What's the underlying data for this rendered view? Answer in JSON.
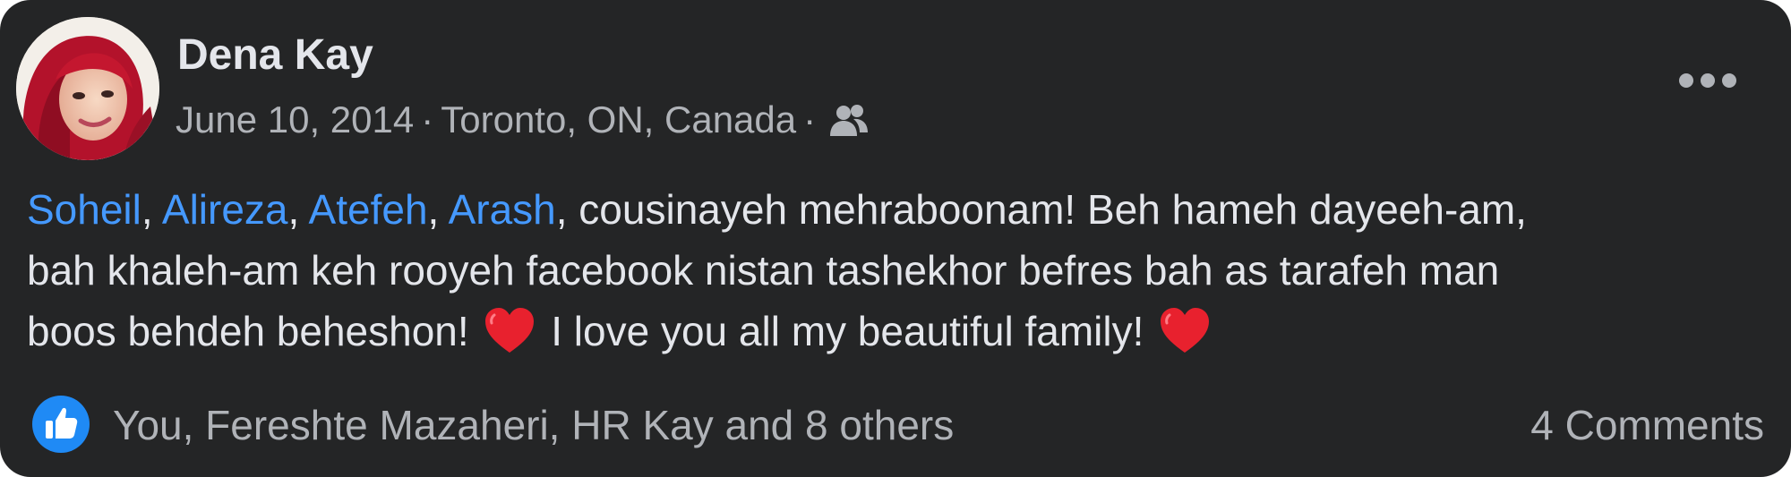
{
  "post": {
    "author": {
      "name": "Dena Kay",
      "avatar_icon": "profile-photo-avatar"
    },
    "meta": {
      "date": "June 10, 2014",
      "separator": "·",
      "location": "Toronto, ON, Canada",
      "audience_icon": "friends-icon"
    },
    "more_icon": "more-options-icon",
    "body": {
      "mentions": [
        "Soheil",
        "Alireza",
        "Atefeh",
        "Arash"
      ],
      "comma": ",",
      "line1_rest": ", cousinayeh mehraboonam! Beh hameh dayeeh-am,",
      "line2": "bah khaleh-am keh rooyeh facebook nistan tashekhor befres bah as tarafeh man",
      "line3_part1": "boos behdeh beheshon!",
      "line3_part2": "I love you all my beautiful family!",
      "emoji_icon": "red-heart-icon"
    },
    "footer": {
      "reaction_icon": "like-icon",
      "reactions_text": "You, Fereshte Mazaheri, HR Kay and 8 others",
      "comments_text": "4 Comments"
    }
  },
  "colors": {
    "card_background": "#242526",
    "primary_text": "#e4e6eb",
    "secondary_text": "#b0b3b8",
    "mention_link": "#4599ff",
    "like_blue": "#1f8af5",
    "heart_red": "#e8212e"
  }
}
